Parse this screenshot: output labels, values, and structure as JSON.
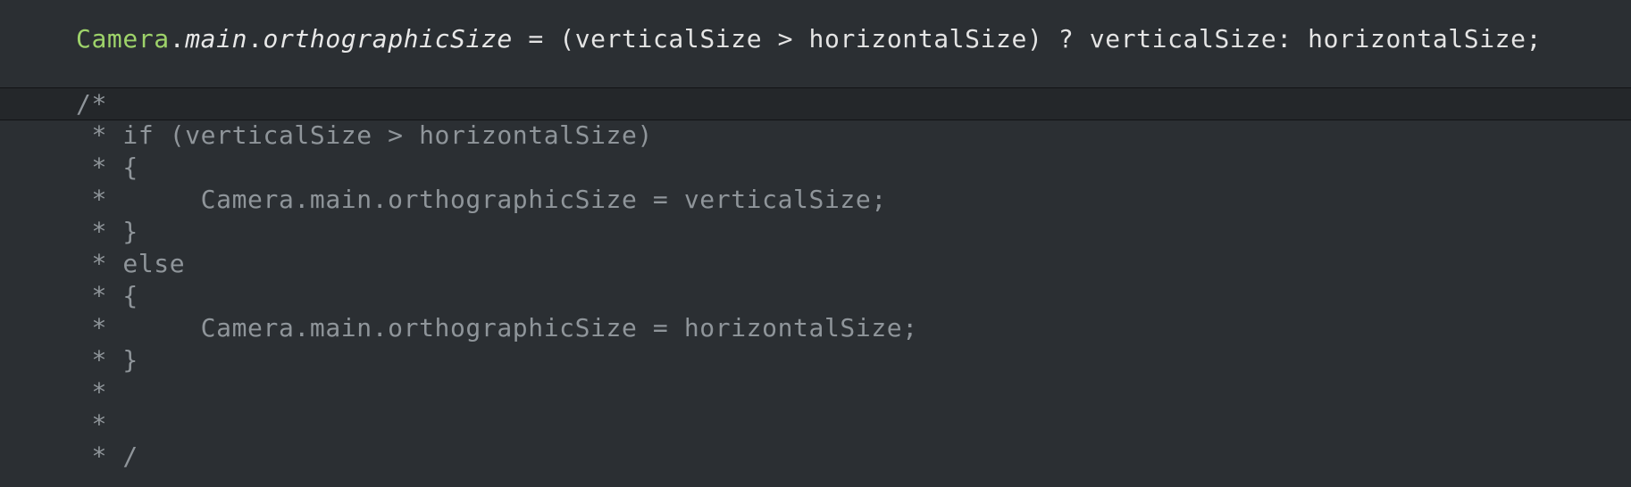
{
  "editor": {
    "statement": {
      "class_name": "Camera",
      "dot1": ".",
      "member1": "main",
      "dot2": ".",
      "member2": "orthographicSize",
      "rest": " = (verticalSize > horizontalSize) ? verticalSize: horizontalSize;"
    },
    "comment_lines": [
      "/*",
      " * if (verticalSize > horizontalSize)",
      " * {",
      " *      Camera.main.orthographicSize = verticalSize;",
      " * }",
      " * else",
      " * {",
      " *      Camera.main.orthographicSize = horizontalSize;",
      " * }",
      " *",
      " *",
      " * /"
    ]
  },
  "colors": {
    "background": "#2b2f33",
    "current_line": "#24272a",
    "class_name": "#9ed36a",
    "comment": "#8f959a",
    "text": "#e4e4e4"
  }
}
